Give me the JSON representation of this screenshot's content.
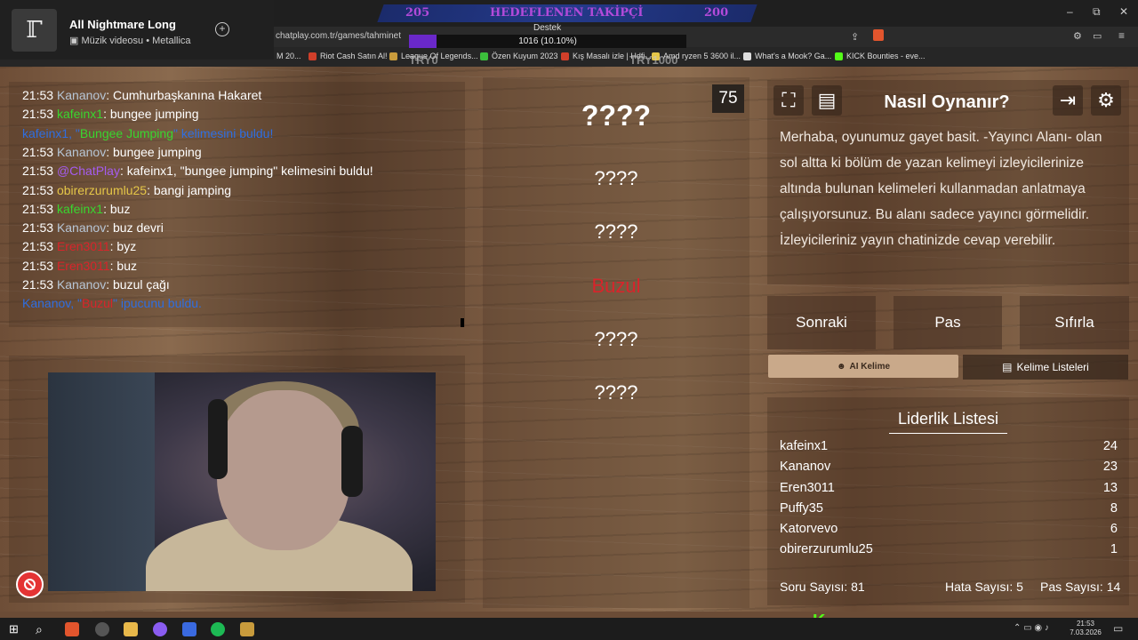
{
  "media": {
    "thumb_glyph": "ℾ",
    "title": "All Nightmare Long",
    "subtitle": "Müzik videosu • Metallica"
  },
  "browser": {
    "url": "chatplay.com.tr/games/tahminet",
    "bookmarks": [
      "M 20...",
      "Riot Cash Satın Al!",
      "League Of Legends...",
      "Özen Kuyum 2023",
      "Kış Masalı izle | Hdfi...",
      "Amd ryzen 5 3600 il...",
      "What's a Mook? Ga...",
      "KICK Bounties - eve..."
    ],
    "window_controls": [
      "–",
      "⧉",
      "✕"
    ]
  },
  "goal": {
    "left_number": "205",
    "title": "HEDEFLENEN TAKİPÇİ",
    "right_number": "200",
    "destek_label": "Destek",
    "progress_text": "1016 (10.10%)",
    "progress_fraction": 0.101,
    "try_left": "TRY0",
    "try_right": "TRY1000"
  },
  "chat": {
    "lines": [
      {
        "time": "21:53",
        "user": "Kananov",
        "user_color": "gray",
        "msg": ": Cumhurbaşkanına Hakaret"
      },
      {
        "time": "21:53",
        "user": "kafeinx1",
        "user_color": "green",
        "msg": ": bungee jumping"
      },
      {
        "system_user": "kafeinx1",
        "system_sep": ", \"",
        "system_word": "Bungee Jumping",
        "system_msg": "\" kelimesini buldu!"
      },
      {
        "time": "21:53",
        "user": "Kananov",
        "user_color": "gray",
        "msg": ": bungee jumping"
      },
      {
        "time": "21:53",
        "user": "@ChatPlay",
        "user_color": "purple",
        "msg": ": kafeinx1, \"bungee jumping\" kelimesini buldu!"
      },
      {
        "time": "21:53",
        "user": "obirerzurumlu25",
        "user_color": "yellow",
        "msg": ": bangi jamping"
      },
      {
        "time": "21:53",
        "user": "kafeinx1",
        "user_color": "green",
        "msg": ": buz"
      },
      {
        "time": "21:53",
        "user": "Kananov",
        "user_color": "gray",
        "msg": ": buz devri"
      },
      {
        "time": "21:53",
        "user": "Eren3011",
        "user_color": "red",
        "msg": ": byz"
      },
      {
        "time": "21:53",
        "user": "Eren3011",
        "user_color": "red",
        "msg": ": buz"
      },
      {
        "time": "21:53",
        "user": "Kananov",
        "user_color": "gray",
        "msg": ": buzul çağı"
      },
      {
        "system_user": "Kananov",
        "system_sep": ", \"",
        "system_word": "Buzul",
        "system_msg": "\" ipucunu buldu."
      }
    ]
  },
  "game": {
    "timer": "75",
    "words": [
      "????",
      "????",
      "????",
      "Buzul",
      "????",
      "????"
    ]
  },
  "info": {
    "title": "Nasıl Oynanır?",
    "text": "Merhaba, oyunumuz gayet basit. -Yayıncı Alanı- olan sol altta ki bölüm de yazan kelimeyi izleyicilerinize altında bulunan kelimeleri kullanmadan anlatmaya çalışıyorsunuz. Bu alanı sadece yayıncı görmelidir. İzleyicileriniz yayın chatinizde cevap verebilir."
  },
  "buttons": {
    "next": "Sonraki",
    "pass": "Pas",
    "reset": "Sıfırla",
    "ai_word": "AI Kelime",
    "word_lists": "Kelime Listeleri"
  },
  "leaderboard": {
    "title": "Liderlik Listesi",
    "rows": [
      {
        "name": "kafeinx1",
        "score": "24"
      },
      {
        "name": "Kananov",
        "score": "23"
      },
      {
        "name": "Eren3011",
        "score": "13"
      },
      {
        "name": "Puffy35",
        "score": "8"
      },
      {
        "name": "Katorvevo",
        "score": "6"
      },
      {
        "name": "obirerzurumlu25",
        "score": "1"
      }
    ],
    "question_count": "Soru Sayısı: 81",
    "error_count": "Hata Sayısı: 5",
    "pass_count": "Pas Sayısı: 14"
  },
  "taskbar": {
    "time": "21:53",
    "date": "7.03.2026"
  },
  "colors": {
    "accent_purple": "#6a28c9",
    "found_red": "#d8242b",
    "system_blue": "#2f6ee0",
    "kick_green": "#53fc18"
  }
}
